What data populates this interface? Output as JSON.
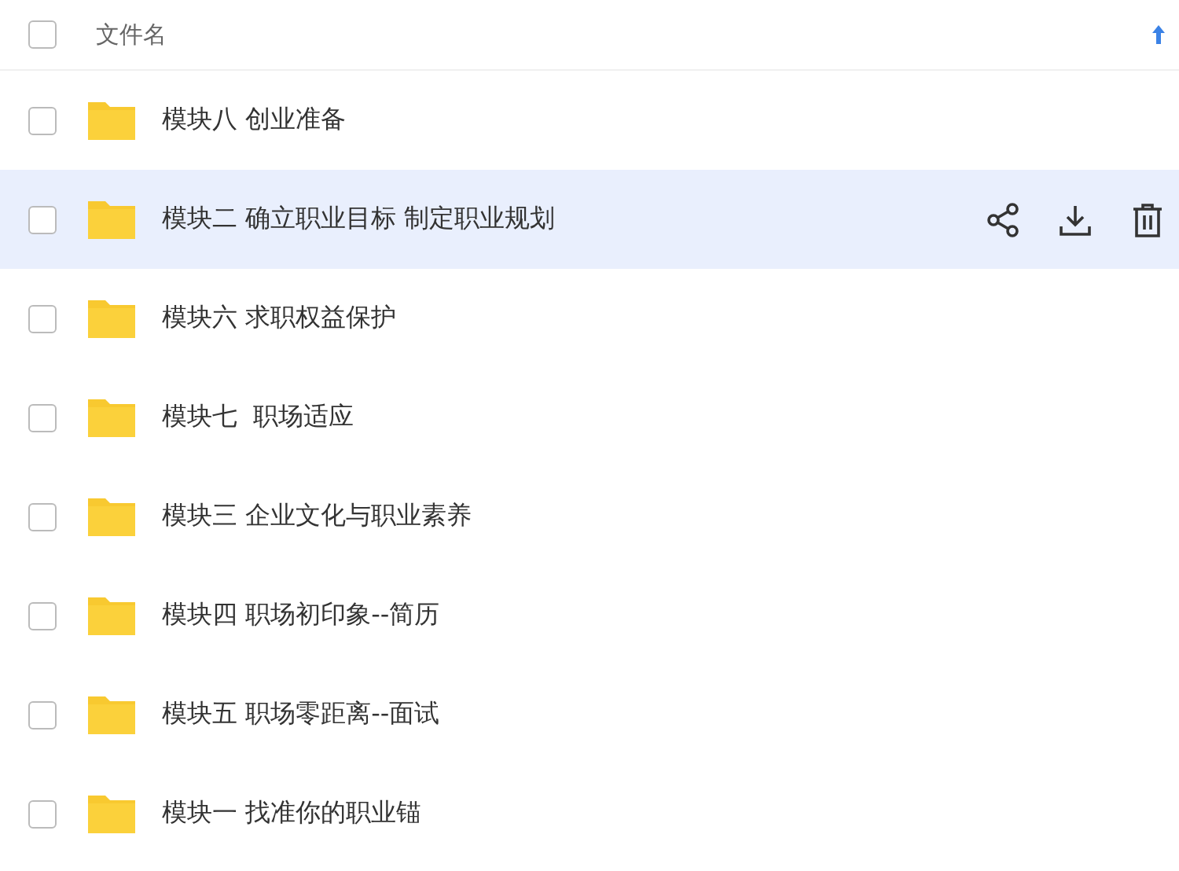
{
  "header": {
    "checked": false,
    "column": "文件名"
  },
  "rows": [
    {
      "name": "模块八 创业准备",
      "checked": false,
      "selected": false
    },
    {
      "name": "模块二 确立职业目标 制定职业规划",
      "checked": false,
      "selected": true
    },
    {
      "name": "模块六 求职权益保护",
      "checked": false,
      "selected": false
    },
    {
      "name": "模块七  职场适应",
      "checked": false,
      "selected": false
    },
    {
      "name": "模块三 企业文化与职业素养",
      "checked": false,
      "selected": false
    },
    {
      "name": "模块四 职场初印象--简历",
      "checked": false,
      "selected": false
    },
    {
      "name": "模块五 职场零距离--面试",
      "checked": false,
      "selected": false
    },
    {
      "name": "模块一 找准你的职业锚",
      "checked": false,
      "selected": false
    }
  ]
}
